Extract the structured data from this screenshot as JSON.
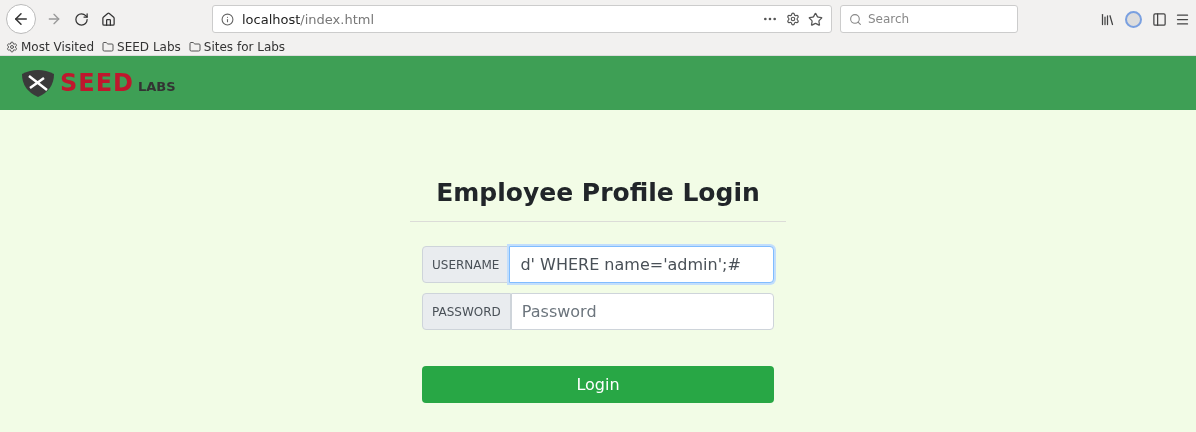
{
  "browser": {
    "url_host": "localhost",
    "url_path": "/index.html",
    "search_placeholder": "Search",
    "bookmarks": [
      {
        "kind": "gear",
        "label": "Most Visited"
      },
      {
        "kind": "folder",
        "label": "SEED Labs"
      },
      {
        "kind": "folder",
        "label": "Sites for Labs"
      }
    ]
  },
  "header": {
    "logo_main": "SEED",
    "logo_sub": "LABS"
  },
  "form": {
    "title": "Employee Profile Login",
    "fields": [
      {
        "label": "USERNAME",
        "value": "d' WHERE name='admin';#",
        "focused": true
      },
      {
        "label": "PASSWORD",
        "placeholder": "Password",
        "focused": false
      }
    ],
    "button": "Login"
  }
}
